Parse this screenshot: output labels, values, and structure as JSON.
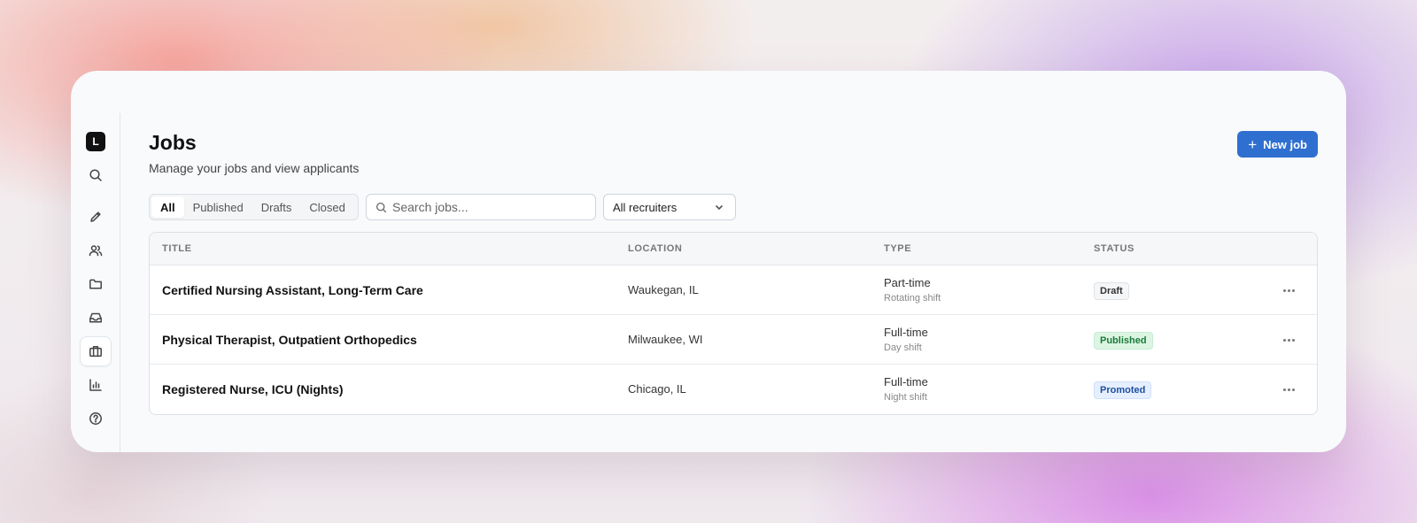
{
  "sidebar": {
    "logo": "L",
    "items": [
      {
        "name": "search",
        "icon": "search-icon"
      },
      {
        "name": "edit",
        "icon": "pencil-icon"
      },
      {
        "name": "users",
        "icon": "users-icon"
      },
      {
        "name": "folder",
        "icon": "folder-icon"
      },
      {
        "name": "inbox",
        "icon": "inbox-icon"
      },
      {
        "name": "jobs",
        "icon": "briefcase-icon",
        "active": true
      },
      {
        "name": "analytics",
        "icon": "bar-chart-icon"
      },
      {
        "name": "help",
        "icon": "help-circle-icon"
      }
    ]
  },
  "header": {
    "title": "Jobs",
    "subtitle": "Manage your jobs and view applicants",
    "new_job_label": "New job"
  },
  "filters": {
    "tabs": [
      "All",
      "Published",
      "Drafts",
      "Closed"
    ],
    "active_tab": "All",
    "search_placeholder": "Search jobs...",
    "search_value": "",
    "recruiter_select": "All recruiters"
  },
  "table": {
    "columns": [
      "TITLE",
      "LOCATION",
      "TYPE",
      "STATUS"
    ],
    "rows": [
      {
        "title": "Certified Nursing Assistant, Long-Term Care",
        "location": "Waukegan, IL",
        "type": "Part-time",
        "shift": "Rotating shift",
        "status": "Draft"
      },
      {
        "title": "Physical Therapist, Outpatient Orthopedics",
        "location": "Milwaukee, WI",
        "type": "Full-time",
        "shift": "Day shift",
        "status": "Published"
      },
      {
        "title": "Registered Nurse, ICU (Nights)",
        "location": "Chicago, IL",
        "type": "Full-time",
        "shift": "Night shift",
        "status": "Promoted"
      }
    ]
  },
  "colors": {
    "accent": "#2f6fd0",
    "draft_bg": "#f5f6f8",
    "draft_text": "#333333",
    "published_bg": "#dcf5e3",
    "published_text": "#1b7a3a",
    "promoted_bg": "#e5efff",
    "promoted_text": "#1e4f9e"
  }
}
